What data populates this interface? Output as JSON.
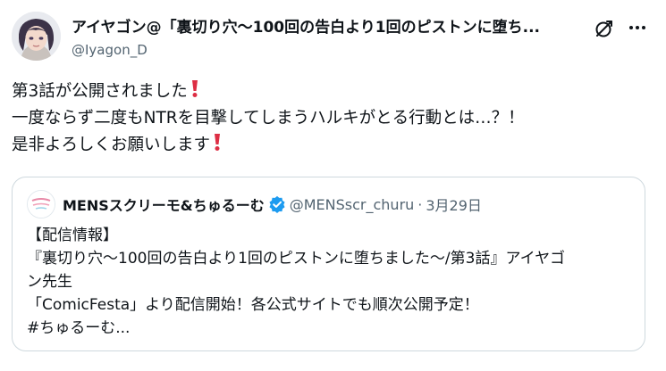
{
  "author": {
    "name": "アイヤゴン@「裏切り穴～100回の告白より1回のピストンに堕ち...",
    "handle": "@Iyagon_D"
  },
  "tweet": {
    "lines": [
      "第3話が公開されました",
      "一度ならず二度もNTRを目撃してしまうハルキがとる行動とは…？！",
      "是非よろしくお願いします"
    ]
  },
  "quote": {
    "author_name": "MENSスクリーモ&ちゅるーむ",
    "author_handle": "@MENSscr_churu",
    "separator": "·",
    "date": "3月29日",
    "lines": [
      "【配信情報】",
      "『裏切り穴～100回の告白より1回のピストンに堕ちました～/第3話』アイヤゴ",
      "ン先生",
      "「ComicFesta」より配信開始！各公式サイトでも順次公開予定！",
      "#ちゅるーむ..."
    ]
  },
  "colors": {
    "text": "#0f1419",
    "secondary": "#536471",
    "border": "#cfd9de",
    "verified": "#1d9bf0",
    "exclamation": "#dd2e44"
  },
  "icons": [
    "avatar",
    "grok-icon",
    "more-icon",
    "exclamation-icon",
    "verified-badge-icon"
  ]
}
